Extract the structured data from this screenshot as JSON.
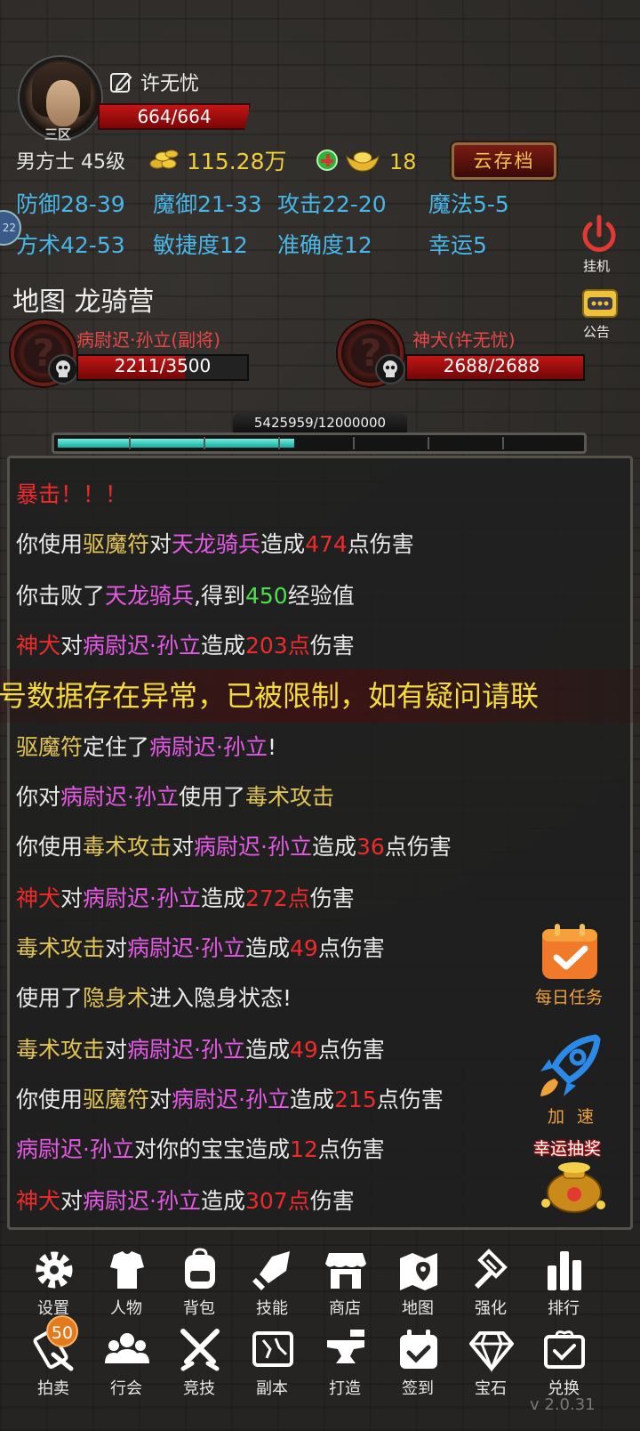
{
  "player": {
    "name": "许无忧",
    "server": "三区",
    "hp": "664/664",
    "class_level": "男方士 45级",
    "gold": "115.28万",
    "ingot": "18",
    "hp_fraction": 1.0
  },
  "buttons": {
    "cloud_save": "云存档",
    "hangup": "挂机",
    "notice": "公告"
  },
  "side_badge": "22",
  "stats": [
    "防御28-39",
    "魔御21-33",
    "攻击22-20",
    "魔法5-5",
    "方术42-53",
    "敏捷度12",
    "准确度12",
    "幸运5"
  ],
  "map": "地图 龙骑营",
  "pets": [
    {
      "name": "病尉迟·孙立(副将)",
      "hp": "2211/3500",
      "hp_fraction": 0.632
    },
    {
      "name": "神犬(许无忧)",
      "hp": "2688/2688",
      "hp_fraction": 1.0
    }
  ],
  "experience": {
    "text": "5425959/12000000",
    "fraction": 0.452
  },
  "log": [
    [
      {
        "t": "暴击！！！",
        "c": "red"
      }
    ],
    [
      {
        "t": "你使用",
        "c": "w"
      },
      {
        "t": "驱魔符",
        "c": "yel"
      },
      {
        "t": "对",
        "c": "w"
      },
      {
        "t": "天龙骑兵",
        "c": "mag"
      },
      {
        "t": "造成",
        "c": "w"
      },
      {
        "t": "474",
        "c": "red"
      },
      {
        "t": "点伤害",
        "c": "w"
      }
    ],
    [
      {
        "t": "你击败了",
        "c": "w"
      },
      {
        "t": "天龙骑兵",
        "c": "mag"
      },
      {
        "t": ",得到",
        "c": "w"
      },
      {
        "t": "450",
        "c": "grn"
      },
      {
        "t": "经验值",
        "c": "w"
      }
    ],
    [
      {
        "t": "神犬",
        "c": "red"
      },
      {
        "t": "对",
        "c": "w"
      },
      {
        "t": "病尉迟·孙立",
        "c": "mag"
      },
      {
        "t": "造成",
        "c": "w"
      },
      {
        "t": "203点",
        "c": "red"
      },
      {
        "t": "伤害",
        "c": "w"
      }
    ],
    [
      {
        "t": "驱魔符",
        "c": "yel"
      },
      {
        "t": "定住了",
        "c": "w"
      },
      {
        "t": "病尉迟·孙立",
        "c": "mag"
      },
      {
        "t": "!",
        "c": "w"
      }
    ],
    [
      {
        "t": "你对",
        "c": "w"
      },
      {
        "t": "病尉迟·孙立",
        "c": "mag"
      },
      {
        "t": "使用了",
        "c": "w"
      },
      {
        "t": "毒术攻击",
        "c": "yel"
      }
    ],
    [
      {
        "t": "你使用",
        "c": "w"
      },
      {
        "t": "毒术攻击",
        "c": "yel"
      },
      {
        "t": "对",
        "c": "w"
      },
      {
        "t": "病尉迟·孙立",
        "c": "mag"
      },
      {
        "t": "造成",
        "c": "w"
      },
      {
        "t": "36",
        "c": "red"
      },
      {
        "t": "点伤害",
        "c": "w"
      }
    ],
    [
      {
        "t": "神犬",
        "c": "red"
      },
      {
        "t": "对",
        "c": "w"
      },
      {
        "t": "病尉迟·孙立",
        "c": "mag"
      },
      {
        "t": "造成",
        "c": "w"
      },
      {
        "t": "272点",
        "c": "red"
      },
      {
        "t": "伤害",
        "c": "w"
      }
    ],
    [
      {
        "t": "毒术攻击",
        "c": "yel"
      },
      {
        "t": "对",
        "c": "w"
      },
      {
        "t": "病尉迟·孙立",
        "c": "mag"
      },
      {
        "t": "造成",
        "c": "w"
      },
      {
        "t": "49",
        "c": "red"
      },
      {
        "t": "点伤害",
        "c": "w"
      }
    ],
    [
      {
        "t": "使用了",
        "c": "w"
      },
      {
        "t": "隐身术",
        "c": "yel"
      },
      {
        "t": "进入隐身状态!",
        "c": "w"
      }
    ],
    [
      {
        "t": "毒术攻击",
        "c": "yel"
      },
      {
        "t": "对",
        "c": "w"
      },
      {
        "t": "病尉迟·孙立",
        "c": "mag"
      },
      {
        "t": "造成",
        "c": "w"
      },
      {
        "t": "49",
        "c": "red"
      },
      {
        "t": "点伤害",
        "c": "w"
      }
    ],
    [
      {
        "t": "你使用",
        "c": "w"
      },
      {
        "t": "驱魔符",
        "c": "yel"
      },
      {
        "t": "对",
        "c": "w"
      },
      {
        "t": "病尉迟·孙立",
        "c": "mag"
      },
      {
        "t": "造成",
        "c": "w"
      },
      {
        "t": "215",
        "c": "red"
      },
      {
        "t": "点伤害",
        "c": "w"
      }
    ],
    [
      {
        "t": "病尉迟·孙立",
        "c": "mag"
      },
      {
        "t": "对你的宝宝造成",
        "c": "w"
      },
      {
        "t": "12",
        "c": "red"
      },
      {
        "t": "点伤害",
        "c": "w"
      }
    ],
    [
      {
        "t": "神犬",
        "c": "red"
      },
      {
        "t": "对",
        "c": "w"
      },
      {
        "t": "病尉迟·孙立",
        "c": "mag"
      },
      {
        "t": "造成",
        "c": "w"
      },
      {
        "t": "307点",
        "c": "red"
      },
      {
        "t": "伤害",
        "c": "w"
      }
    ]
  ],
  "warning": "号数据存在异常，已被限制，如有疑问请联",
  "side_buttons": {
    "daily": "每日任务",
    "speed": "加 速",
    "lucky": "幸运抽奖"
  },
  "nav_row1": [
    "设置",
    "人物",
    "背包",
    "技能",
    "商店",
    "地图",
    "强化",
    "排行"
  ],
  "nav_row2": [
    "拍卖",
    "行会",
    "竞技",
    "副本",
    "打造",
    "签到",
    "宝石",
    "兑换"
  ],
  "auction_badge": "50",
  "version": "v 2.0.31",
  "colors": {
    "hp_red": "#c31515",
    "stat_blue": "#49b6e8",
    "gold_yellow": "#f0cc3a",
    "xp_teal": "#3ed6c6",
    "warning_yellow": "#f5dc3a"
  }
}
